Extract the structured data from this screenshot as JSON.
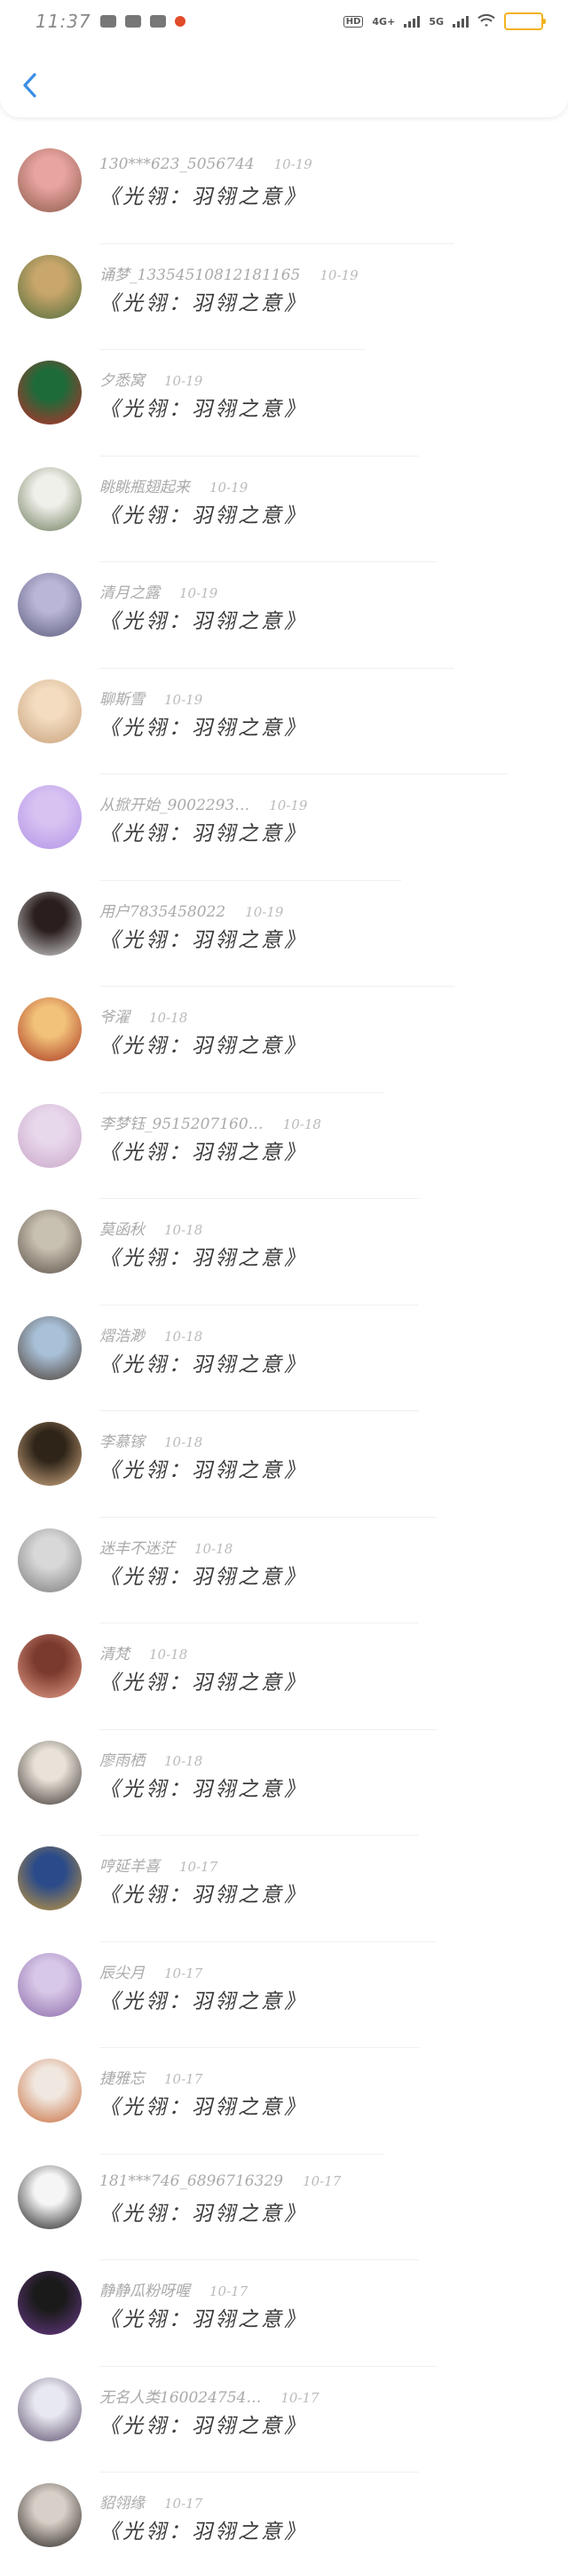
{
  "status_bar": {
    "time": "11:37",
    "hd_label": "HD",
    "net1": "4G+",
    "net2": "5G"
  },
  "comments": [
    {
      "user": "130***623_5056744",
      "date": "10-19",
      "title": "《光翎：羽翎之意》",
      "avatar_colors": [
        "#e8a4a0",
        "#8a5a4a"
      ]
    },
    {
      "user": "诵梦_13354510812181165",
      "date": "10-19",
      "title": "《光翎：羽翎之意》",
      "avatar_colors": [
        "#c9a66b",
        "#4e6b3a"
      ]
    },
    {
      "user": "夕悉窝",
      "date": "10-19",
      "title": "《光翎：羽翎之意》",
      "avatar_colors": [
        "#1e6b3a",
        "#c22a2a"
      ]
    },
    {
      "user": "眺眺瓶翅起来",
      "date": "10-19",
      "title": "《光翎：羽翎之意》",
      "avatar_colors": [
        "#f0f0ea",
        "#6b7a5a"
      ]
    },
    {
      "user": "清月之露",
      "date": "10-19",
      "title": "《光翎：羽翎之意》",
      "avatar_colors": [
        "#b9b6d8",
        "#5b5a7a"
      ]
    },
    {
      "user": "聊斯雪",
      "date": "10-19",
      "title": "《光翎：羽翎之意》",
      "avatar_colors": [
        "#f3dcc0",
        "#c6a07a"
      ]
    },
    {
      "user": "从掀开始_9002293…",
      "date": "10-19",
      "title": "《光翎：羽翎之意》",
      "avatar_colors": [
        "#d8c2f2",
        "#b294e6"
      ]
    },
    {
      "user": "用户7835458022",
      "date": "10-19",
      "title": "《光翎：羽翎之意》",
      "avatar_colors": [
        "#2a1e1e",
        "#d8d8d8"
      ]
    },
    {
      "user": "爷濯",
      "date": "10-18",
      "title": "《光翎：羽翎之意》",
      "avatar_colors": [
        "#f2c27a",
        "#a8341e"
      ]
    },
    {
      "user": "李梦钰_9515207160…",
      "date": "10-18",
      "title": "《光翎：羽翎之意》",
      "avatar_colors": [
        "#e8d8ec",
        "#c9a6c8"
      ]
    },
    {
      "user": "莫函秋",
      "date": "10-18",
      "title": "《光翎：羽翎之意》",
      "avatar_colors": [
        "#c8c0b0",
        "#5a5048"
      ]
    },
    {
      "user": "熠浩渺",
      "date": "10-18",
      "title": "《光翎：羽翎之意》",
      "avatar_colors": [
        "#a8c0d8",
        "#4a3a2e"
      ]
    },
    {
      "user": "李慕镓",
      "date": "10-18",
      "title": "《光翎：羽翎之意》",
      "avatar_colors": [
        "#2e2418",
        "#d8b088"
      ]
    },
    {
      "user": "迷丰不迷茫",
      "date": "10-18",
      "title": "《光翎：羽翎之意》",
      "avatar_colors": [
        "#d8d8d8",
        "#7a7a7a"
      ]
    },
    {
      "user": "清梵",
      "date": "10-18",
      "title": "《光翎：羽翎之意》",
      "avatar_colors": [
        "#7a3a2e",
        "#e8a08a"
      ]
    },
    {
      "user": "廖雨栖",
      "date": "10-18",
      "title": "《光翎：羽翎之意》",
      "avatar_colors": [
        "#e8e2d8",
        "#3a3230"
      ]
    },
    {
      "user": "哼延羊喜",
      "date": "10-17",
      "title": "《光翎：羽翎之意》",
      "avatar_colors": [
        "#2a4a8a",
        "#c89a3a"
      ]
    },
    {
      "user": "辰尖月",
      "date": "10-17",
      "title": "《光翎：羽翎之意》",
      "avatar_colors": [
        "#d8c8e8",
        "#8a6aa8"
      ]
    },
    {
      "user": "捷雅忘",
      "date": "10-17",
      "title": "《光翎：羽翎之意》",
      "avatar_colors": [
        "#f0e8e0",
        "#c86a3a"
      ]
    },
    {
      "user": "181***746_6896716329",
      "date": "10-17",
      "title": "《光翎：羽翎之意》",
      "avatar_colors": [
        "#f5f5f5",
        "#1a1a1a"
      ]
    },
    {
      "user": "静静瓜粉呀喔",
      "date": "10-17",
      "title": "《光翎：羽翎之意》",
      "avatar_colors": [
        "#1a1a1a",
        "#6a3a8a"
      ]
    },
    {
      "user": "无名人类160024754…",
      "date": "10-17",
      "title": "《光翎：羽翎之意》",
      "avatar_colors": [
        "#e8e8f0",
        "#5a4a6a"
      ]
    },
    {
      "user": "貂翎缘",
      "date": "10-17",
      "title": "《光翎：羽翎之意》",
      "avatar_colors": [
        "#d8d0c8",
        "#2a2420"
      ]
    }
  ]
}
